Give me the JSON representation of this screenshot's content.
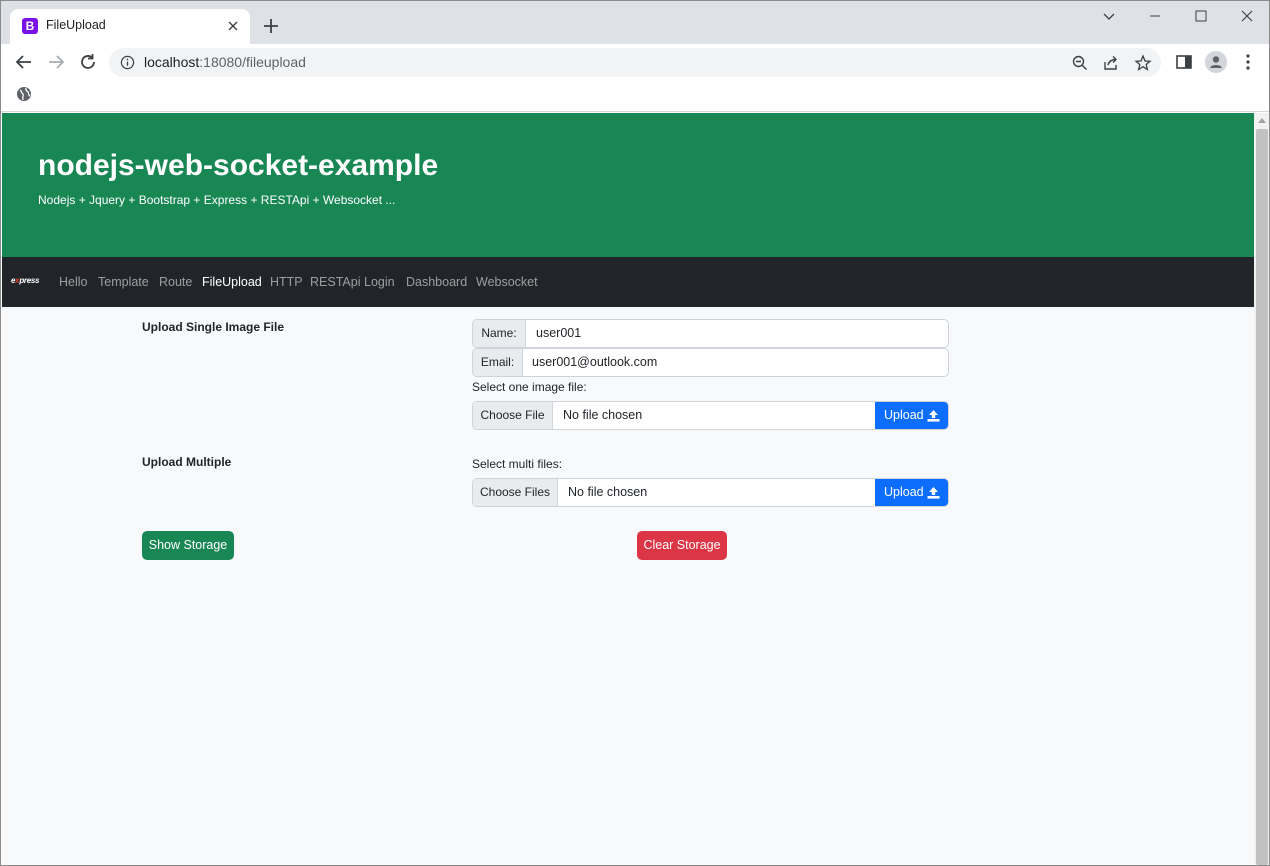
{
  "browser": {
    "tab_title": "FileUpload",
    "tab_favicon_letter": "B",
    "url_host": "localhost",
    "url_path": ":18080/fileupload"
  },
  "hero": {
    "title": "nodejs-web-socket-example",
    "subtitle": "Nodejs + Jquery + Bootstrap + Express + RESTApi + Websocket ..."
  },
  "navbar": {
    "brand_prefix": "e",
    "brand_accent": "x",
    "brand_suffix": "press",
    "links": [
      {
        "label": "Hello"
      },
      {
        "label": "Template"
      },
      {
        "label": "Route"
      },
      {
        "label": "FileUpload"
      },
      {
        "label": "HTTP"
      },
      {
        "label": "RESTApi"
      },
      {
        "label": "Login"
      },
      {
        "label": "Dashboard"
      },
      {
        "label": "Websocket"
      }
    ],
    "active": "FileUpload"
  },
  "single": {
    "section_label": "Upload Single Image File",
    "name_addon": "Name:",
    "name_value": "user001",
    "email_addon": "Email:",
    "email_value": "user001@outlook.com",
    "file_hint": "Select one image file:",
    "choose_label": "Choose File",
    "file_status": "No file chosen",
    "upload_label": "Upload"
  },
  "multiple": {
    "section_label": "Upload Multiple",
    "file_hint": "Select multi files:",
    "choose_label": "Choose Files",
    "file_status": "No file chosen",
    "upload_label": "Upload"
  },
  "actions": {
    "show_storage": "Show Storage",
    "clear_storage": "Clear Storage"
  },
  "colors": {
    "hero_bg": "#198754",
    "navbar_bg": "#212529",
    "primary": "#0d6efd",
    "danger": "#dc3545",
    "success": "#198754"
  }
}
